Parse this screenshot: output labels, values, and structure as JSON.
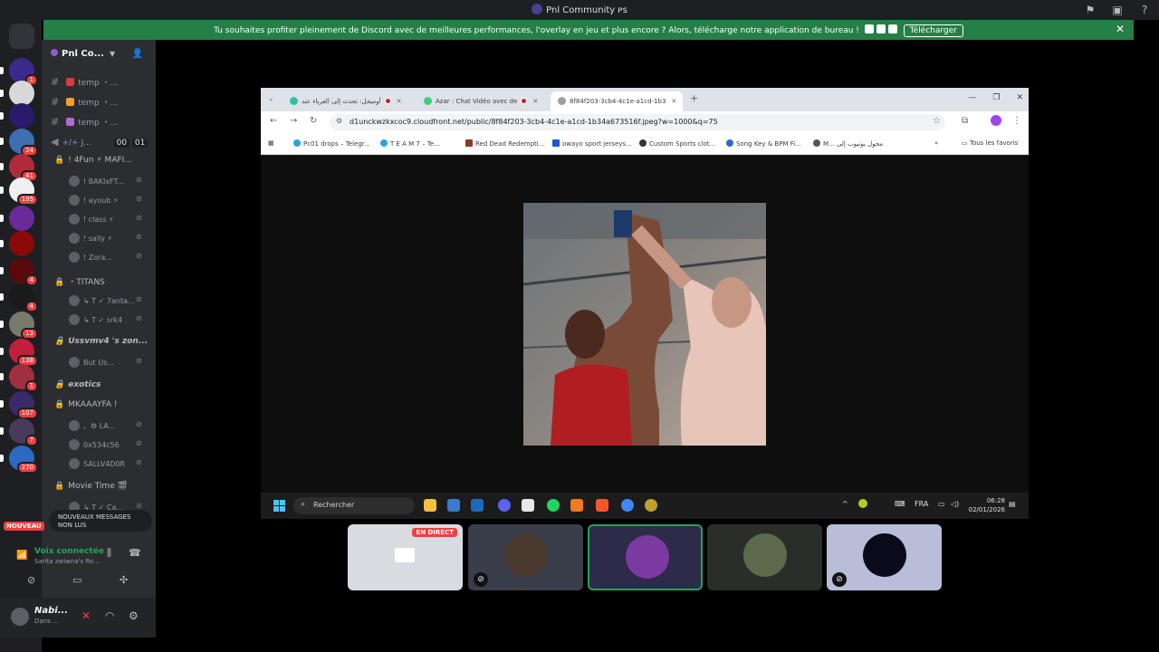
{
  "window": {
    "title": "Pnl Community",
    "title_suffix": "ᴘs"
  },
  "banner": {
    "text": "Tu souhaites profiter pleinement de Discord avec de meilleures performances, l'overlay en jeu et plus encore ? Alors, télécharge notre application de bureau !",
    "download_label": "Télécharger",
    "close_glyph": "✕"
  },
  "guilds": [
    {
      "badge": "1",
      "color": "#3a2a8a"
    },
    {
      "badge": "",
      "color": "#d8d8d8"
    },
    {
      "badge": "",
      "color": "#2a1a6a"
    },
    {
      "badge": "24",
      "color": "#3d6fb0"
    },
    {
      "badge": "41",
      "color": "#b02a3a"
    },
    {
      "badge": "195",
      "color": "#f0f0f0"
    },
    {
      "badge": "",
      "color": "#6a2a9a"
    },
    {
      "badge": "",
      "color": "#8a0a0a"
    },
    {
      "badge": "4",
      "color": "#5a0a0a"
    },
    {
      "badge": "4",
      "color": "#1a1a1a"
    },
    {
      "badge": "13",
      "color": "#7a7a6a"
    },
    {
      "badge": "138",
      "color": "#c0203a"
    },
    {
      "badge": "1",
      "color": "#a03040"
    },
    {
      "badge": "107",
      "color": "#3a2a6a"
    },
    {
      "badge": "7",
      "color": "#4a3a5a"
    },
    {
      "badge": "270",
      "color": "#2a6ac0"
    }
  ],
  "server": {
    "name": "Pnl Co..."
  },
  "text_channels": [
    {
      "name": "temp ・...",
      "emo_color": "#d83c3e"
    },
    {
      "name": "temp ・...",
      "emo_color": "#f0a030"
    },
    {
      "name": "temp ・...",
      "emo_color": "#b06ad0"
    }
  ],
  "stage_channel": {
    "name": "J...",
    "counts": [
      "00",
      "01"
    ]
  },
  "voice_channels": [
    {
      "name": "! 4Fun ⚡ MAFI...",
      "users": [
        "! BAKIxFT...",
        "! ayoub ⚡",
        "! class ⚡",
        "! sally ⚡",
        "! Zora..."
      ]
    },
    {
      "name": "・TITANS",
      "users": [
        "↳ T ✓ 7anta...",
        "↳ T ✓ srk4"
      ]
    },
    {
      "name": "Ussvmv4 's zon...",
      "users": [
        "But Us..."
      ]
    },
    {
      "name": "exotics",
      "users": []
    },
    {
      "name": "MKAAAYFA !",
      "users": [
        "、⚙ LA...",
        "0x534c56",
        "SALLV4D0R"
      ]
    },
    {
      "name": "Movie Time 🎬",
      "users": [
        "↳ T ✓ Ca..."
      ]
    }
  ],
  "new_messages": {
    "label": "NOUVEAUX MESSAGES NON LUS",
    "badge": "NOUVEAU"
  },
  "voice_status": {
    "title": "Voix connectée",
    "subtitle": "Sarita zwiwna's Ro..."
  },
  "user": {
    "name": "Nabi...",
    "status": "Dans ..."
  },
  "browser": {
    "tabs": [
      {
        "title": "أوميجل: تحدث إلى الغرباء عند",
        "fav_color": "#2fbfa8",
        "recording": true
      },
      {
        "title": "Azar : Chat Vidéo avec de",
        "fav_color": "#3ccf7a",
        "recording": true
      },
      {
        "title": "8f84f203-3cb4-4c1e-a1cd-1b3",
        "fav_color": "#9aa0a6",
        "recording": false
      }
    ],
    "new_tab": "+",
    "url": "d1unckwzkxcoc9.cloudfront.net/public/8f84f203-3cb4-4c1e-a1cd-1b34a673516f.jpeg?w=1000&q=75",
    "bookmarks": [
      {
        "label": "Pc01 drops – Telegr...",
        "color": "#2aa3e0"
      },
      {
        "label": "T E A M 7 – Te...",
        "color": "#2aa3e0"
      },
      {
        "label": "Red Dead Redempti...",
        "color": "#8a3a2a"
      },
      {
        "label": "owayo sport jerseys...",
        "color": "#1a5ad0"
      },
      {
        "label": "Custom Sports clot...",
        "color": "#333333"
      },
      {
        "label": "Song Key & BPM Fi...",
        "color": "#2a6ad0"
      },
      {
        "label": "M... محول يوتيوب إلى",
        "color": "#555555"
      }
    ],
    "all_bookmarks": "Tous les favoris"
  },
  "taskbar": {
    "search": "Rechercher",
    "lang": "FRA",
    "time": "06:28",
    "date": "02/01/2026"
  },
  "tiles": {
    "live_label": "EN DIRECT"
  }
}
